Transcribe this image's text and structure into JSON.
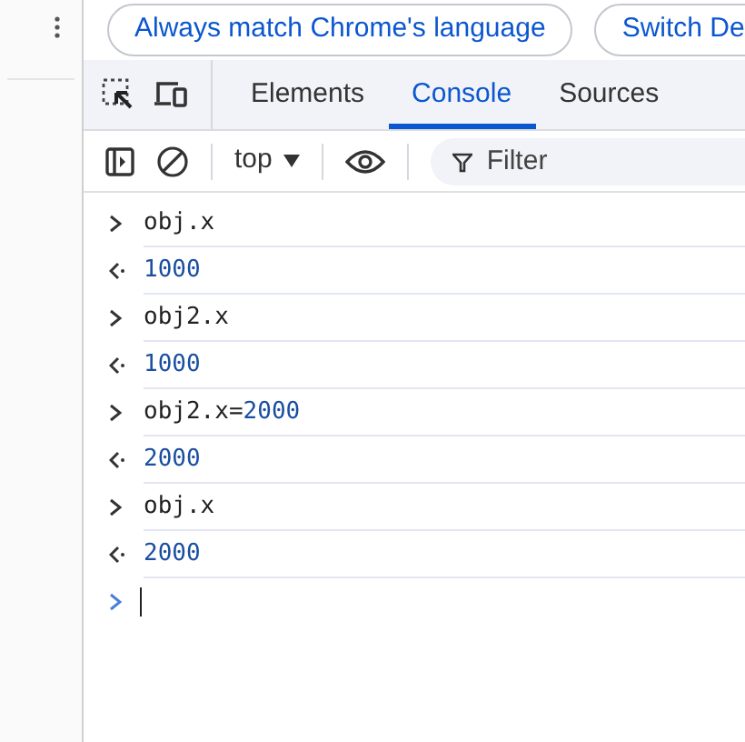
{
  "banner": {
    "buttons": [
      {
        "label": "Always match Chrome's language"
      },
      {
        "label": "Switch De"
      }
    ]
  },
  "tabs": [
    {
      "label": "Elements",
      "selected": false
    },
    {
      "label": "Console",
      "selected": true
    },
    {
      "label": "Sources",
      "selected": false
    }
  ],
  "toolbar": {
    "context": "top",
    "filter": {
      "placeholder": "Filter"
    }
  },
  "console": [
    {
      "kind": "input",
      "tokens": [
        {
          "kind": "plain",
          "text": "obj.x"
        }
      ]
    },
    {
      "kind": "output",
      "tokens": [
        {
          "kind": "number",
          "text": "1000"
        }
      ]
    },
    {
      "kind": "input",
      "tokens": [
        {
          "kind": "plain",
          "text": "obj2.x"
        }
      ]
    },
    {
      "kind": "output",
      "tokens": [
        {
          "kind": "number",
          "text": "1000"
        }
      ]
    },
    {
      "kind": "input",
      "tokens": [
        {
          "kind": "plain",
          "text": "obj2.x="
        },
        {
          "kind": "number",
          "text": "2000"
        }
      ]
    },
    {
      "kind": "output",
      "tokens": [
        {
          "kind": "number",
          "text": "2000"
        }
      ]
    },
    {
      "kind": "input",
      "tokens": [
        {
          "kind": "plain",
          "text": "obj.x"
        }
      ]
    },
    {
      "kind": "output",
      "tokens": [
        {
          "kind": "number",
          "text": "2000"
        }
      ]
    }
  ]
}
